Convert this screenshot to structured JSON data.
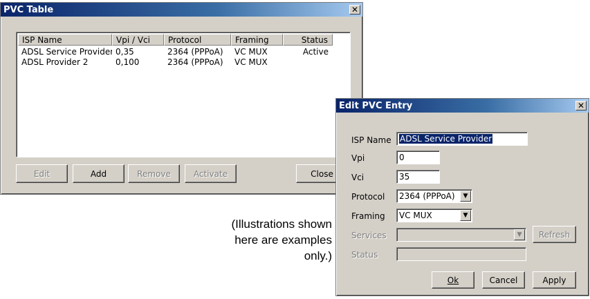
{
  "pvc_table": {
    "title": "PVC Table",
    "close_icon": "close-icon",
    "columns": [
      "ISP Name",
      "Vpi / Vci",
      "Protocol",
      "Framing",
      "Status"
    ],
    "rows": [
      [
        "ADSL Service Provider",
        "0,35",
        "2364 (PPPoA)",
        "VC MUX",
        "Active"
      ],
      [
        "ADSL Provider 2",
        "0,100",
        "2364 (PPPoA)",
        "VC MUX",
        ""
      ]
    ],
    "buttons": {
      "edit": "Edit",
      "add": "Add",
      "remove": "Remove",
      "activate": "Activate",
      "close": "Close"
    }
  },
  "caption": "(Illustrations shown here are examples only.)",
  "edit_dialog": {
    "title": "Edit PVC Entry",
    "close_icon": "close-icon",
    "fields": {
      "isp_name": {
        "label": "ISP Name",
        "value": "ADSL Service Provider"
      },
      "vpi": {
        "label": "Vpi",
        "value": "0"
      },
      "vci": {
        "label": "Vci",
        "value": "35"
      },
      "protocol": {
        "label": "Protocol",
        "value": "2364 (PPPoA)"
      },
      "framing": {
        "label": "Framing",
        "value": "VC MUX"
      },
      "services": {
        "label": "Services",
        "value": ""
      },
      "status": {
        "label": "Status",
        "value": ""
      }
    },
    "buttons": {
      "refresh": "Refresh",
      "ok": "Ok",
      "cancel": "Cancel",
      "apply": "Apply"
    }
  }
}
